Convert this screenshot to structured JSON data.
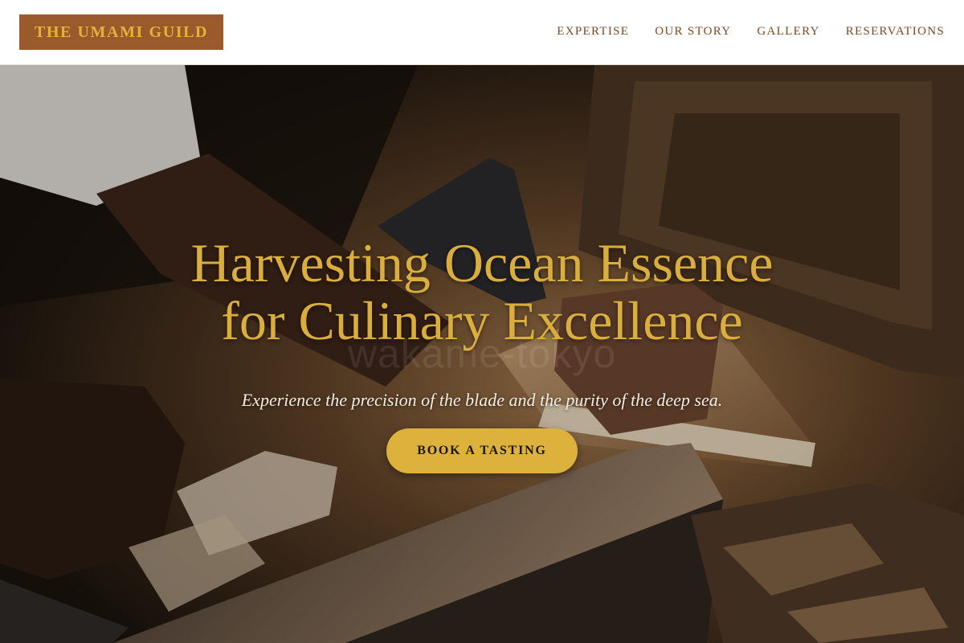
{
  "brand": {
    "logo_text": "THE UMAMI GUILD",
    "logo_bg": "#9b5a2c",
    "logo_color": "#e3b23c"
  },
  "nav": {
    "items": [
      {
        "label": "EXPERTISE"
      },
      {
        "label": "OUR STORY"
      },
      {
        "label": "GALLERY"
      },
      {
        "label": "RESERVATIONS"
      }
    ]
  },
  "hero": {
    "headline_line1": "Harvesting Ocean Essence",
    "headline_line2": "for Culinary Excellence",
    "watermark": "wakame-tokyo",
    "subtitle": "Experience the precision of the blade and the purity of the deep sea.",
    "cta_label": "BOOK A TASTING",
    "image": "hero-photo-woodworking-hands",
    "accent_color": "#d9ae3c"
  }
}
